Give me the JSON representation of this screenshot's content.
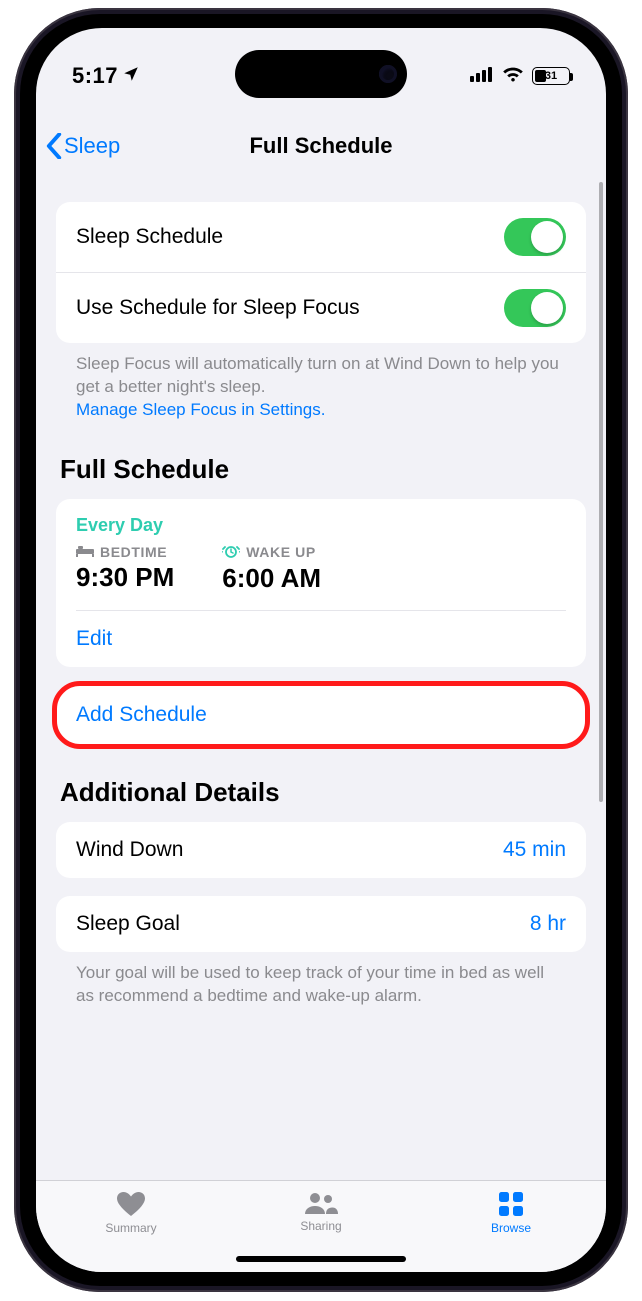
{
  "status": {
    "time": "5:17",
    "battery_pct": "31"
  },
  "nav": {
    "back_label": "Sleep",
    "title": "Full Schedule"
  },
  "toggles": {
    "sleep_schedule_label": "Sleep Schedule",
    "use_focus_label": "Use Schedule for Sleep Focus"
  },
  "focus_note": {
    "text": "Sleep Focus will automatically turn on at Wind Down to help you get a better night's sleep.",
    "link": "Manage Sleep Focus in Settings."
  },
  "schedule_section_title": "Full Schedule",
  "schedule": {
    "days": "Every Day",
    "bedtime_label": "BEDTIME",
    "bedtime": "9:30 PM",
    "wakeup_label": "WAKE UP",
    "wakeup": "6:00 AM",
    "edit_label": "Edit"
  },
  "add_schedule_label": "Add Schedule",
  "details_section_title": "Additional Details",
  "details": {
    "wind_down_label": "Wind Down",
    "wind_down_value": "45 min",
    "sleep_goal_label": "Sleep Goal",
    "sleep_goal_value": "8 hr",
    "goal_note": "Your goal will be used to keep track of your time in bed as well as recommend a bedtime and wake-up alarm."
  },
  "tabs": {
    "summary": "Summary",
    "sharing": "Sharing",
    "browse": "Browse"
  }
}
